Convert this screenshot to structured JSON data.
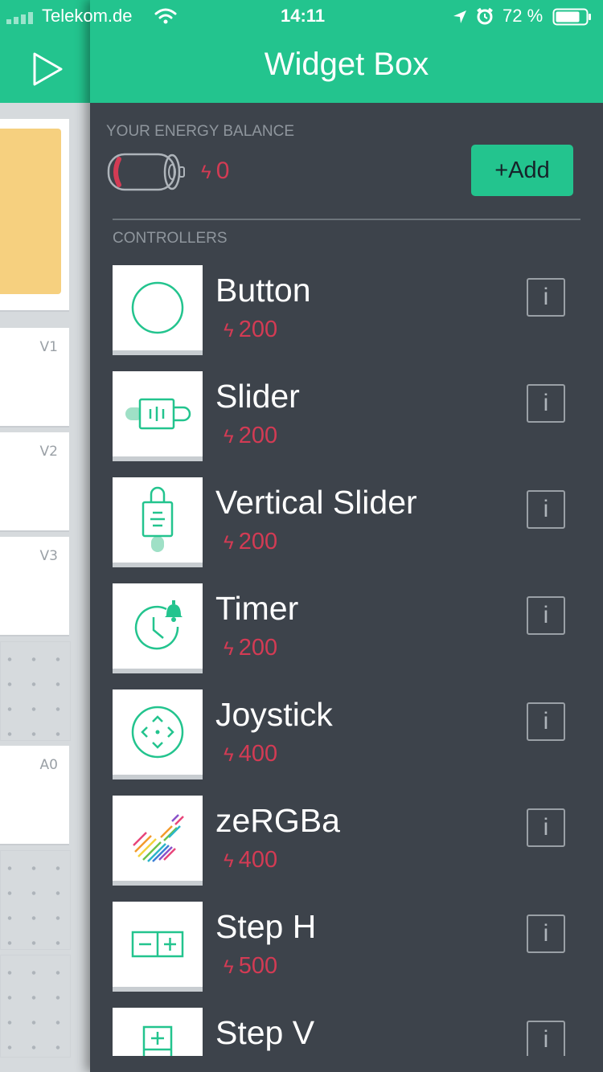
{
  "status_bar": {
    "carrier": "Telekom.de",
    "time": "14:11",
    "battery": "72 %"
  },
  "panel": {
    "title": "Widget Box",
    "energy_label": "YOUR ENERGY BALANCE",
    "energy_value": "0",
    "add_label": "+Add",
    "section_label": "CONTROLLERS",
    "info_label": "i"
  },
  "widgets": [
    {
      "name": "Button",
      "cost": "200",
      "icon": "button-icon"
    },
    {
      "name": "Slider",
      "cost": "200",
      "icon": "slider-icon"
    },
    {
      "name": "Vertical Slider",
      "cost": "200",
      "icon": "vertical-slider-icon"
    },
    {
      "name": "Timer",
      "cost": "200",
      "icon": "timer-icon"
    },
    {
      "name": "Joystick",
      "cost": "400",
      "icon": "joystick-icon"
    },
    {
      "name": "zeRGBa",
      "cost": "400",
      "icon": "zergba-icon"
    },
    {
      "name": "Step H",
      "cost": "500",
      "icon": "step-h-icon"
    },
    {
      "name": "Step V",
      "cost": "",
      "icon": "step-v-icon"
    }
  ],
  "background_dashboard": {
    "pins": [
      "V1",
      "V2",
      "V3",
      "A0"
    ]
  },
  "colors": {
    "accent": "#23c48e",
    "panel_bg": "#3d434b",
    "energy_red": "#d33b54"
  }
}
